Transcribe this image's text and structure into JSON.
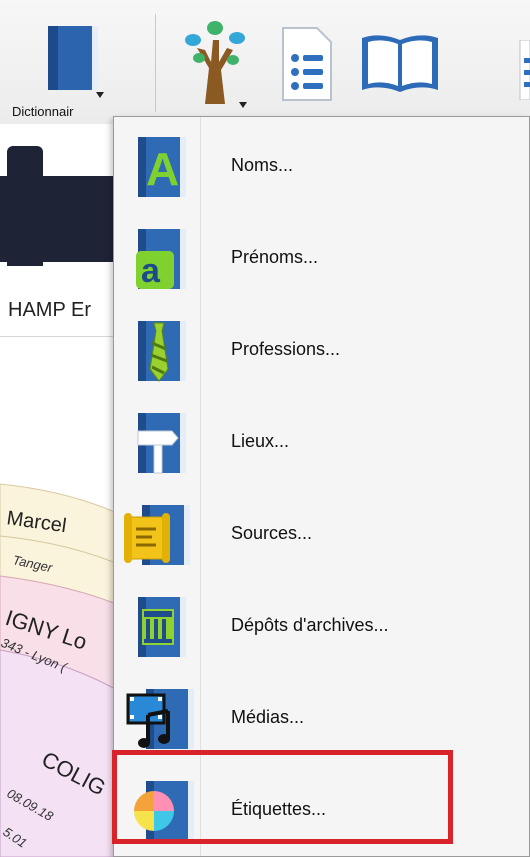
{
  "toolbar": {
    "dictionary_label": "Dictionnair",
    "buttons": [
      {
        "name": "dictionary-book-icon"
      },
      {
        "name": "tree-icon"
      },
      {
        "name": "list-icon"
      },
      {
        "name": "open-book-icon"
      }
    ]
  },
  "background": {
    "person_name": "HAMP Er",
    "fan_labels": [
      "Marcel",
      "Tanger",
      "IGNY Lo",
      "343 - Lyon (",
      "COLIG",
      "08.09.18",
      "5.01"
    ]
  },
  "menu": {
    "items": [
      {
        "label": "Noms...",
        "icon": "letter-A-book-icon"
      },
      {
        "label": "Prénoms...",
        "icon": "letter-a-book-icon"
      },
      {
        "label": "Professions...",
        "icon": "tie-book-icon"
      },
      {
        "label": "Lieux...",
        "icon": "signpost-book-icon"
      },
      {
        "label": "Sources...",
        "icon": "scroll-book-icon"
      },
      {
        "label": "Dépôts d'archives...",
        "icon": "archive-building-book-icon"
      },
      {
        "label": "Médias...",
        "icon": "media-film-music-book-icon"
      },
      {
        "label": "Étiquettes...",
        "icon": "color-wheel-book-icon"
      }
    ],
    "highlighted_item": "Étiquettes..."
  },
  "colors": {
    "highlight": "#d9232b",
    "book_blue": "#2f6bb5",
    "dark_panel": "#1f2336"
  }
}
